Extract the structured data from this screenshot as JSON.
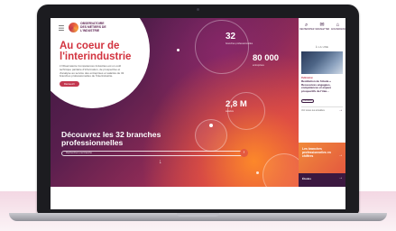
{
  "site": {
    "logo_text": "Observatoire des métiers de l'industrie"
  },
  "hero": {
    "title": "Au coeur de l'interindustrie",
    "intro": "L'Observatoire Compétences Industries est un outil technique paritaire d'information, de prospective et d'analyse au service des entreprises et salariés de 32 branches professionnelles de l'interindustrie.",
    "cta_label": "Découvrir"
  },
  "stats": [
    {
      "value": "32",
      "label": "branches professionnelles"
    },
    {
      "value": "80 000",
      "label": "entreprises"
    },
    {
      "value": "2,8 M",
      "label": "salariés"
    }
  ],
  "branches": {
    "title": "Découvrez les 32 branches professionnelles",
    "search_placeholder": "Recherchez une branche"
  },
  "toolbar": {
    "items": [
      {
        "icon": "search-icon",
        "label": "Rechercher"
      },
      {
        "icon": "mail-icon",
        "label": "Newsletter"
      },
      {
        "icon": "bank-icon",
        "label": "Gouvernance"
      }
    ]
  },
  "news": {
    "section_label": "À LA UNE",
    "tag": "Publication",
    "title": "Restitution de l'étude « Ressources engagées, compétences et enjeux prospectifs de l'inte...",
    "button_label": "Découvrir",
    "more_label": "Voir toutes les actualités"
  },
  "promo": {
    "text": "Les branches professionnelles en chiffres"
  },
  "studies": {
    "label": "Études"
  },
  "colors": {
    "accent": "#d2333f",
    "dark": "#3b1840",
    "orange": "#e4593f"
  }
}
